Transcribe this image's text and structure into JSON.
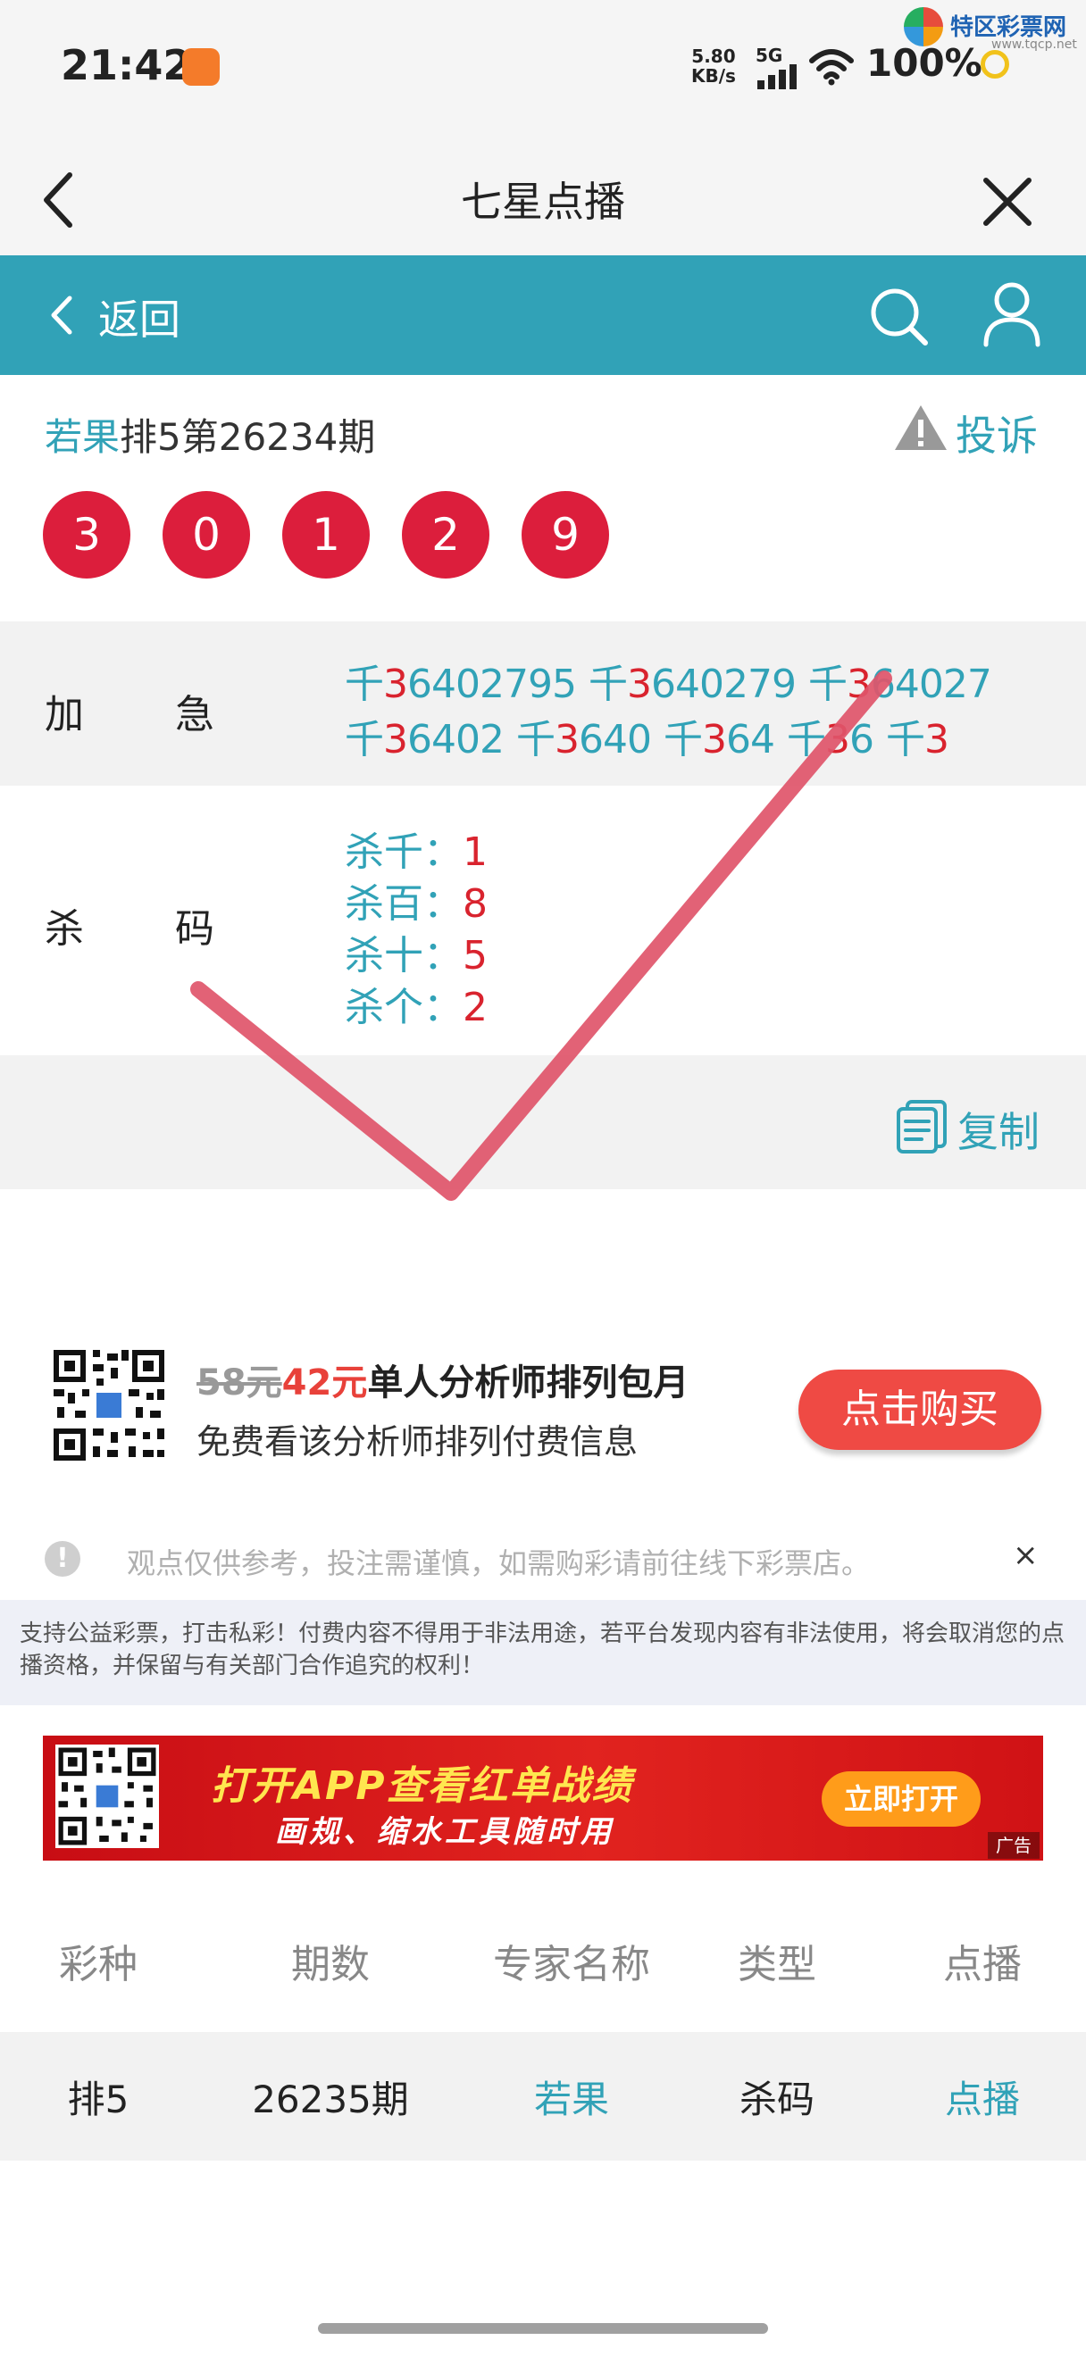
{
  "status_bar": {
    "time": "21:42",
    "net_speed": "5.80",
    "net_unit": "KB/s",
    "signal": "5G",
    "battery": "100%"
  },
  "watermark": {
    "name": "特区彩票网",
    "url": "www.tqcp.net"
  },
  "titlebar": {
    "title": "七星点播"
  },
  "nav": {
    "back_label": "返回"
  },
  "issue": {
    "expert": "若果",
    "title_rest": "排5第26234期",
    "report_label": "投诉"
  },
  "draw_numbers": [
    "3",
    "0",
    "1",
    "2",
    "9"
  ],
  "jiaji": {
    "label_left": "加",
    "label_right": "急",
    "line1": [
      {
        "pre": "千",
        "digit": "3",
        "rest": "6402795"
      },
      {
        "pre": "千",
        "digit": "3",
        "rest": "640279"
      },
      {
        "pre": "千",
        "digit": "3",
        "rest": "64027"
      }
    ],
    "line2": [
      {
        "pre": "千",
        "digit": "3",
        "rest": "6402"
      },
      {
        "pre": "千",
        "digit": "3",
        "rest": "640"
      },
      {
        "pre": "千",
        "digit": "3",
        "rest": "64"
      },
      {
        "pre": "千",
        "digit": "3",
        "rest": "6"
      },
      {
        "pre": "千",
        "digit": "3",
        "rest": ""
      }
    ]
  },
  "shama": {
    "label_left": "杀",
    "label_right": "码",
    "items": [
      {
        "label": "杀千：",
        "value": "1"
      },
      {
        "label": "杀百：",
        "value": "8"
      },
      {
        "label": "杀十：",
        "value": "5"
      },
      {
        "label": "杀个：",
        "value": "2"
      }
    ]
  },
  "copy": {
    "label": "复制"
  },
  "promo": {
    "old_price": "58元",
    "new_price": "42元",
    "title": "单人分析师排列包月",
    "subtitle": "免费看该分析师排列付费信息",
    "buy_label": "点击购买"
  },
  "notice": {
    "text": "观点仅供参考，投注需谨慎，如需购彩请前往线下彩票店。",
    "close": "×"
  },
  "disclaimer": "支持公益彩票，打击私彩！付费内容不得用于非法用途，若平台发现内容有非法使用，将会取消您的点播资格，并保留与有关部门合作追究的权利！",
  "banner": {
    "title": "打开APP查看红单战绩",
    "subtitle": "画规、缩水工具随时用",
    "button": "立即打开",
    "ad_tag": "广告"
  },
  "table": {
    "headers": [
      "彩种",
      "期数",
      "专家名称",
      "类型",
      "点播"
    ],
    "row": [
      "排5",
      "26235期",
      "若果",
      "杀码",
      "点播"
    ]
  },
  "colors": {
    "teal": "#31a2b7",
    "ball_red": "#dc1e3c",
    "digit_red": "#d9232e",
    "buy_button": "#ef4a44",
    "checkmark": "#e0556a"
  }
}
